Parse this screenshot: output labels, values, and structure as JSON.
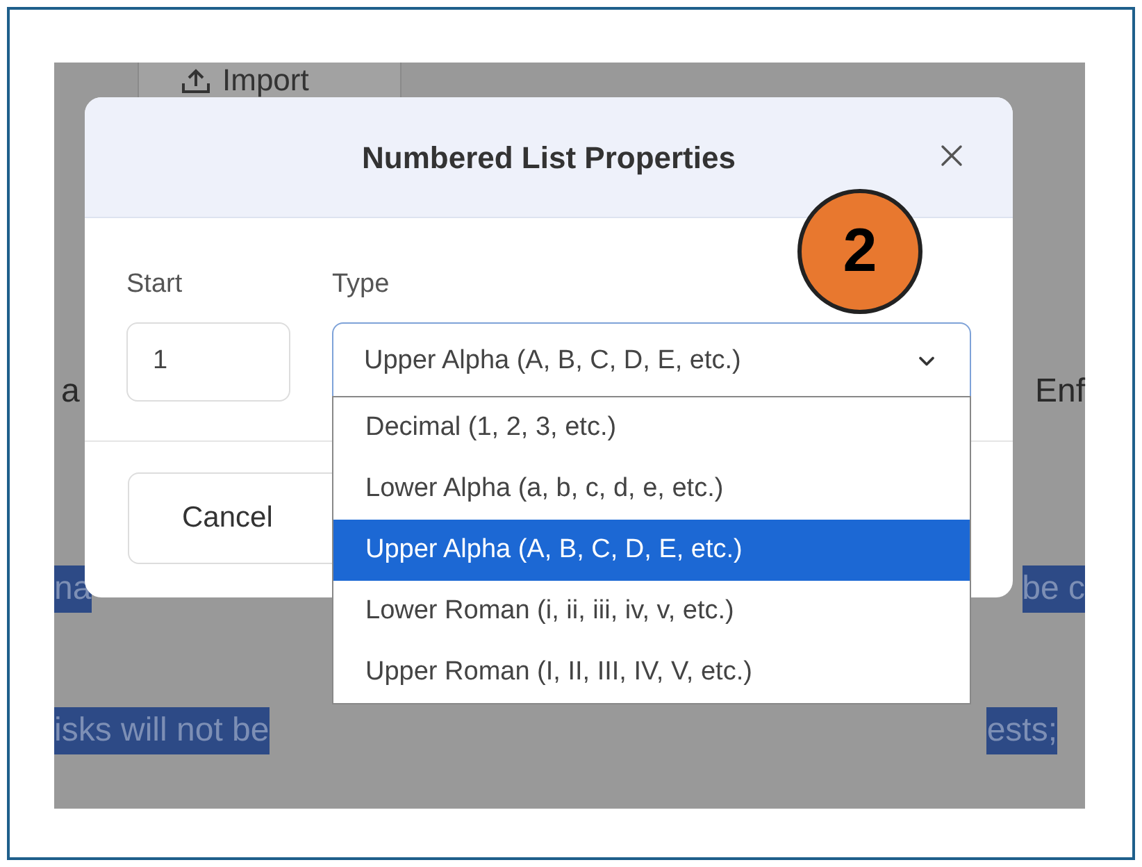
{
  "background": {
    "import_button": "Import",
    "rows": [
      {
        "left": {
          "text": "a",
          "highlighted": false
        },
        "right": {
          "text": "Enf",
          "highlighted": false
        }
      },
      {
        "left": {
          "text": "na",
          "highlighted": true
        },
        "right": {
          "text": "be c",
          "highlighted": true
        }
      },
      {
        "left": {
          "text": "isks will not be",
          "highlighted": true
        },
        "right": {
          "text": "ests;",
          "highlighted": true
        }
      }
    ]
  },
  "dialog": {
    "title": "Numbered List Properties",
    "start": {
      "label": "Start",
      "value": "1"
    },
    "type": {
      "label": "Type",
      "value": "Upper Alpha (A, B, C, D, E, etc.)",
      "expanded": true,
      "options": [
        {
          "label": "Decimal (1, 2, 3, etc.)",
          "selected": false
        },
        {
          "label": "Lower Alpha (a, b, c, d, e, etc.)",
          "selected": false
        },
        {
          "label": "Upper Alpha (A, B, C, D, E, etc.)",
          "selected": true
        },
        {
          "label": "Lower Roman (i, ii, iii, iv, v, etc.)",
          "selected": false
        },
        {
          "label": "Upper Roman (I, II, III, IV, V, etc.)",
          "selected": false
        }
      ]
    },
    "cancel": "Cancel"
  },
  "step_badge": "2"
}
